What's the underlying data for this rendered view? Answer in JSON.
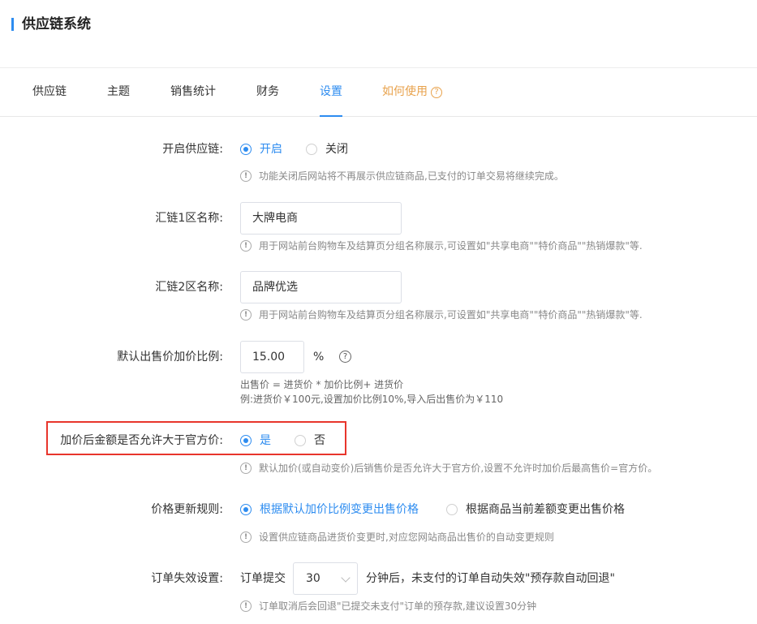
{
  "header": {
    "title": "供应链系统"
  },
  "tabs": [
    {
      "label": "供应链"
    },
    {
      "label": "主题"
    },
    {
      "label": "销售统计"
    },
    {
      "label": "财务"
    },
    {
      "label": "设置"
    },
    {
      "label": "如何使用"
    }
  ],
  "active_tab": "设置",
  "form": {
    "enable": {
      "label": "开启供应链:",
      "options": [
        "开启",
        "关闭"
      ],
      "selected": "开启",
      "hint": "功能关闭后网站将不再展示供应链商品,已支付的订单交易将继续完成。"
    },
    "zone1": {
      "label": "汇链1区名称:",
      "value": "大牌电商",
      "hint": "用于网站前台购物车及结算页分组名称展示,可设置如\"共享电商\"\"特价商品\"\"热销爆款\"等."
    },
    "zone2": {
      "label": "汇链2区名称:",
      "value": "品牌优选",
      "hint": "用于网站前台购物车及结算页分组名称展示,可设置如\"共享电商\"\"特价商品\"\"热销爆款\"等."
    },
    "markup": {
      "label": "默认出售价加价比例:",
      "value": "15.00",
      "unit": "%",
      "formula": "出售价 = 进货价 * 加价比例+ 进货价",
      "example": "例:进货价￥100元,设置加价比例10%,导入后出售价为￥110"
    },
    "exceed": {
      "label": "加价后金额是否允许大于官方价:",
      "options": [
        "是",
        "否"
      ],
      "selected": "是",
      "hint": "默认加价(或自动变价)后销售价是否允许大于官方价,设置不允许时加价后最高售价=官方价。"
    },
    "price_rule": {
      "label": "价格更新规则:",
      "options": [
        "根据默认加价比例变更出售价格",
        "根据商品当前差额变更出售价格"
      ],
      "selected": "根据默认加价比例变更出售价格",
      "hint": "设置供应链商品进货价变更时,对应您网站商品出售价的自动变更规则"
    },
    "order_expire": {
      "label": "订单失效设置:",
      "prefix": "订单提交",
      "minutes": "30",
      "suffix": "分钟后，未支付的订单自动失效\"预存款自动回退\"",
      "hint": "订单取消后会回退\"已提交未支付\"订单的预存款,建议设置30分钟"
    }
  },
  "colors": {
    "primary": "#2d8cf0",
    "help": "#e8a24c",
    "highlight": "#e8352c"
  },
  "icons": {
    "info": "info-circle-icon",
    "help": "question-circle-icon",
    "dropdown": "chevron-down-icon"
  }
}
